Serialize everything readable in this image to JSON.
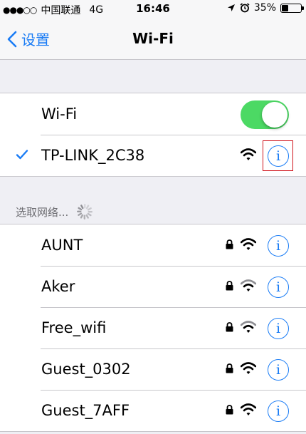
{
  "status_bar": {
    "signal": "●●●○○",
    "carrier": "中国联通",
    "network": "4G",
    "time": "16:46",
    "battery_percent": "35%",
    "battery_level": 0.35
  },
  "nav": {
    "back_label": "设置",
    "title": "Wi-Fi"
  },
  "wifi_toggle": {
    "label": "Wi-Fi",
    "on": true
  },
  "connected": {
    "ssid": "TP-LINK_2C38"
  },
  "section_header": "选取网络...",
  "networks": [
    {
      "ssid": "AUNT"
    },
    {
      "ssid": "Aker"
    },
    {
      "ssid": "Free_wifi"
    },
    {
      "ssid": "Guest_0302"
    },
    {
      "ssid": "Guest_7AFF"
    }
  ],
  "colors": {
    "accent": "#1a7cf5",
    "toggle_on": "#4cd964",
    "highlight": "#d0141c"
  }
}
